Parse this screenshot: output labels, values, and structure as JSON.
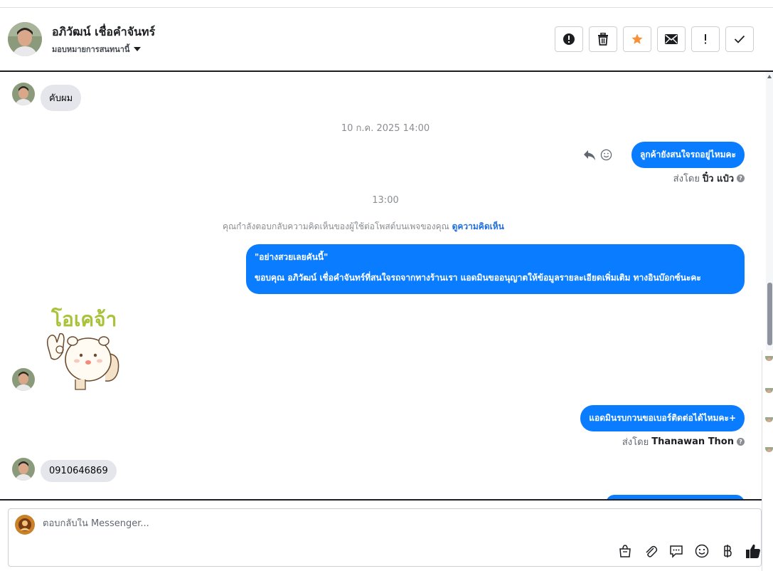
{
  "header": {
    "contact_name": "อภิวัฒน์ เชื่อคำจันทร์",
    "assign_label": "มอบหมายการสนทนานี้",
    "actions": [
      {
        "name": "spam-button",
        "icon": "alert-circle-icon"
      },
      {
        "name": "delete-button",
        "icon": "trash-icon"
      },
      {
        "name": "star-button",
        "icon": "star-icon"
      },
      {
        "name": "mark-unread-button",
        "icon": "envelope-icon"
      },
      {
        "name": "follow-up-button",
        "icon": "exclamation-icon"
      },
      {
        "name": "done-button",
        "icon": "check-icon"
      }
    ]
  },
  "messages": {
    "m1_text": "คับผม",
    "ts1": "10 ก.ค. 2025 14:00",
    "m2_text": "ลูกค้ายังสนใจรถอยู่ไหมคะ",
    "m2_sent_prefix": "ส่งโดย",
    "m2_sender": "ปิ๋ว แป๋ว",
    "ts2": "13:00",
    "notice_text": "คุณกำลังตอบกลับความคิดเห็นของผู้ใช้ต่อโพสต์บนเพจของคุณ",
    "notice_link": "ดูความคิดเห็น",
    "m3_line1": "\"อย่างสวยเลยคันนี้\"",
    "m3_line2": "ขอบคุณ อภิวัฒน์ เชื่อคำจันทร์ที่สนใจรถจากทางร้านเรา แอดมินขออนุญาตให้ข้อมูลรายละเอียดเพิ่มเติม ทางอินบ๊อกซ์นะคะ",
    "sticker_text": "โอเคจ้า",
    "m4_text": "แอดมินรบกวนขอเบอร์ติดต่อได้ไหมคะ+",
    "m4_sent_prefix": "ส่งโดย",
    "m4_sender": "Thanawan Thon",
    "m5_text": "0910646869"
  },
  "composer": {
    "placeholder": "ตอบกลับใน Messenger...",
    "tools": [
      "shopping-bag-icon",
      "paperclip-icon",
      "saved-reply-icon",
      "emoji-icon",
      "baht-icon",
      "thumbs-up-icon"
    ]
  },
  "colors": {
    "outgoing_bubble": "#0a7cff",
    "incoming_bubble": "#e4e6eb",
    "star": "#f7923b",
    "link": "#216fdb"
  }
}
